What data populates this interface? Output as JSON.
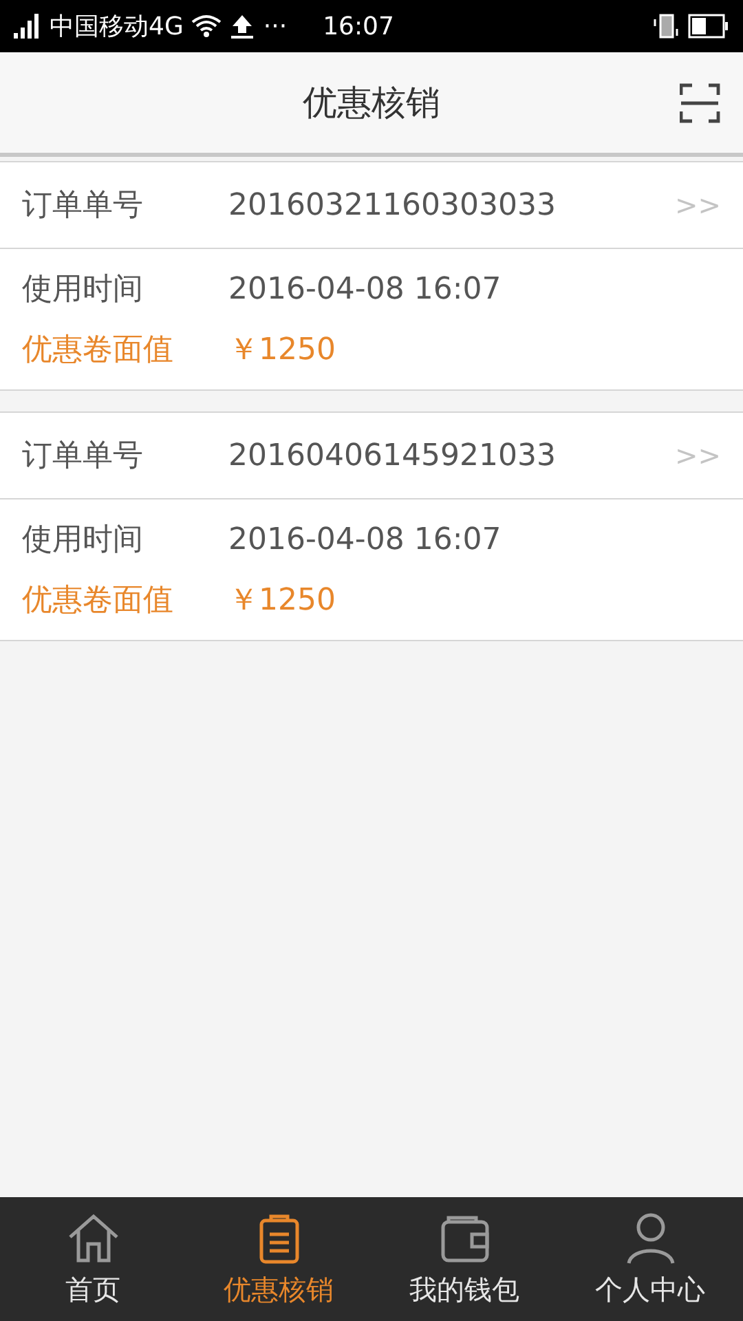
{
  "status_bar": {
    "carrier": "中国移动4G",
    "dots": "···",
    "time": "16:07"
  },
  "header": {
    "title": "优惠核销"
  },
  "records": [
    {
      "order_label": "订单单号",
      "order_no": "20160321160303033",
      "more": ">>",
      "time_label": "使用时间",
      "time": "2016-04-08 16:07",
      "value_label": "优惠卷面值",
      "value": "￥1250"
    },
    {
      "order_label": "订单单号",
      "order_no": "20160406145921033",
      "more": ">>",
      "time_label": "使用时间",
      "time": "2016-04-08 16:07",
      "value_label": "优惠卷面值",
      "value": "￥1250"
    }
  ],
  "tabs": [
    {
      "kind": "home",
      "label": "首页",
      "selected": false
    },
    {
      "kind": "clipboard",
      "label": "优惠核销",
      "selected": true
    },
    {
      "kind": "wallet",
      "label": "我的钱包",
      "selected": false
    },
    {
      "kind": "person",
      "label": "个人中心",
      "selected": false
    }
  ]
}
